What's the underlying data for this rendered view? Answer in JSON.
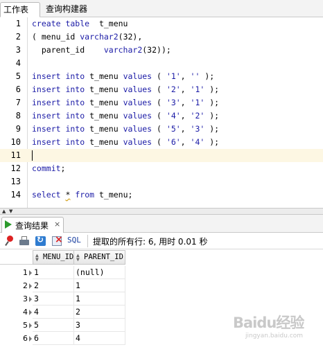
{
  "tabs": {
    "worksheet": "工作表",
    "query_builder": "查询构建器"
  },
  "editor": {
    "lines": [
      {
        "no": "1",
        "parts": [
          [
            "kw",
            "create table"
          ],
          [
            "",
            "  t_menu"
          ]
        ]
      },
      {
        "no": "2",
        "parts": [
          [
            "",
            "( menu_id "
          ],
          [
            "kw",
            "varchar2"
          ],
          [
            "",
            "(32),"
          ]
        ]
      },
      {
        "no": "3",
        "parts": [
          [
            "",
            "  parent_id    "
          ],
          [
            "kw",
            "varchar2"
          ],
          [
            "",
            "(32));"
          ]
        ]
      },
      {
        "no": "4",
        "parts": []
      },
      {
        "no": "5",
        "parts": [
          [
            "kw",
            "insert into"
          ],
          [
            "",
            " t_menu "
          ],
          [
            "kw",
            "values"
          ],
          [
            "",
            " ( "
          ],
          [
            "str",
            "'1'"
          ],
          [
            "",
            ", "
          ],
          [
            "str",
            "''"
          ],
          [
            "",
            " );"
          ]
        ]
      },
      {
        "no": "6",
        "parts": [
          [
            "kw",
            "insert into"
          ],
          [
            "",
            " t_menu "
          ],
          [
            "kw",
            "values"
          ],
          [
            "",
            " ( "
          ],
          [
            "str",
            "'2'"
          ],
          [
            "",
            ", "
          ],
          [
            "str",
            "'1'"
          ],
          [
            "",
            " );"
          ]
        ]
      },
      {
        "no": "7",
        "parts": [
          [
            "kw",
            "insert into"
          ],
          [
            "",
            " t_menu "
          ],
          [
            "kw",
            "values"
          ],
          [
            "",
            " ( "
          ],
          [
            "str",
            "'3'"
          ],
          [
            "",
            ", "
          ],
          [
            "str",
            "'1'"
          ],
          [
            "",
            " );"
          ]
        ]
      },
      {
        "no": "8",
        "parts": [
          [
            "kw",
            "insert into"
          ],
          [
            "",
            " t_menu "
          ],
          [
            "kw",
            "values"
          ],
          [
            "",
            " ( "
          ],
          [
            "str",
            "'4'"
          ],
          [
            "",
            ", "
          ],
          [
            "str",
            "'2'"
          ],
          [
            "",
            " );"
          ]
        ]
      },
      {
        "no": "9",
        "parts": [
          [
            "kw",
            "insert into"
          ],
          [
            "",
            " t_menu "
          ],
          [
            "kw",
            "values"
          ],
          [
            "",
            " ( "
          ],
          [
            "str",
            "'5'"
          ],
          [
            "",
            ", "
          ],
          [
            "str",
            "'3'"
          ],
          [
            "",
            " );"
          ]
        ]
      },
      {
        "no": "10",
        "parts": [
          [
            "kw",
            "insert into"
          ],
          [
            "",
            " t_menu "
          ],
          [
            "kw",
            "values"
          ],
          [
            "",
            " ( "
          ],
          [
            "str",
            "'6'"
          ],
          [
            "",
            ", "
          ],
          [
            "str",
            "'4'"
          ],
          [
            "",
            " );"
          ]
        ]
      },
      {
        "no": "11",
        "parts": [],
        "current": true
      },
      {
        "no": "12",
        "parts": [
          [
            "kw",
            "commit"
          ],
          [
            "",
            ";"
          ]
        ]
      },
      {
        "no": "13",
        "parts": []
      },
      {
        "no": "14",
        "parts": [
          [
            "kw",
            "select"
          ],
          [
            "",
            " "
          ],
          [
            "squiggle",
            "*"
          ],
          [
            "",
            " "
          ],
          [
            "kw",
            "from"
          ],
          [
            "",
            " t_menu;"
          ]
        ]
      }
    ]
  },
  "results": {
    "tab_label": "查询结果",
    "close_glyph": "×",
    "sql_label": "SQL",
    "status": "提取的所有行: 6, 用时 0.01 秒",
    "columns": [
      "MENU_ID",
      "PARENT_ID"
    ],
    "rows": [
      {
        "no": "1",
        "menu_id": "1",
        "parent_id": "(null)"
      },
      {
        "no": "2",
        "menu_id": "2",
        "parent_id": "1"
      },
      {
        "no": "3",
        "menu_id": "3",
        "parent_id": "1"
      },
      {
        "no": "4",
        "menu_id": "4",
        "parent_id": "2"
      },
      {
        "no": "5",
        "menu_id": "5",
        "parent_id": "3"
      },
      {
        "no": "6",
        "menu_id": "6",
        "parent_id": "4"
      }
    ]
  },
  "watermark": {
    "logo": "Baidu经验",
    "sub": "jingyan.baidu.com"
  },
  "colors": {
    "keyword": "#1a1aa6",
    "current_line": "#fdf7e3",
    "run_icon": "#2c9a2c"
  }
}
